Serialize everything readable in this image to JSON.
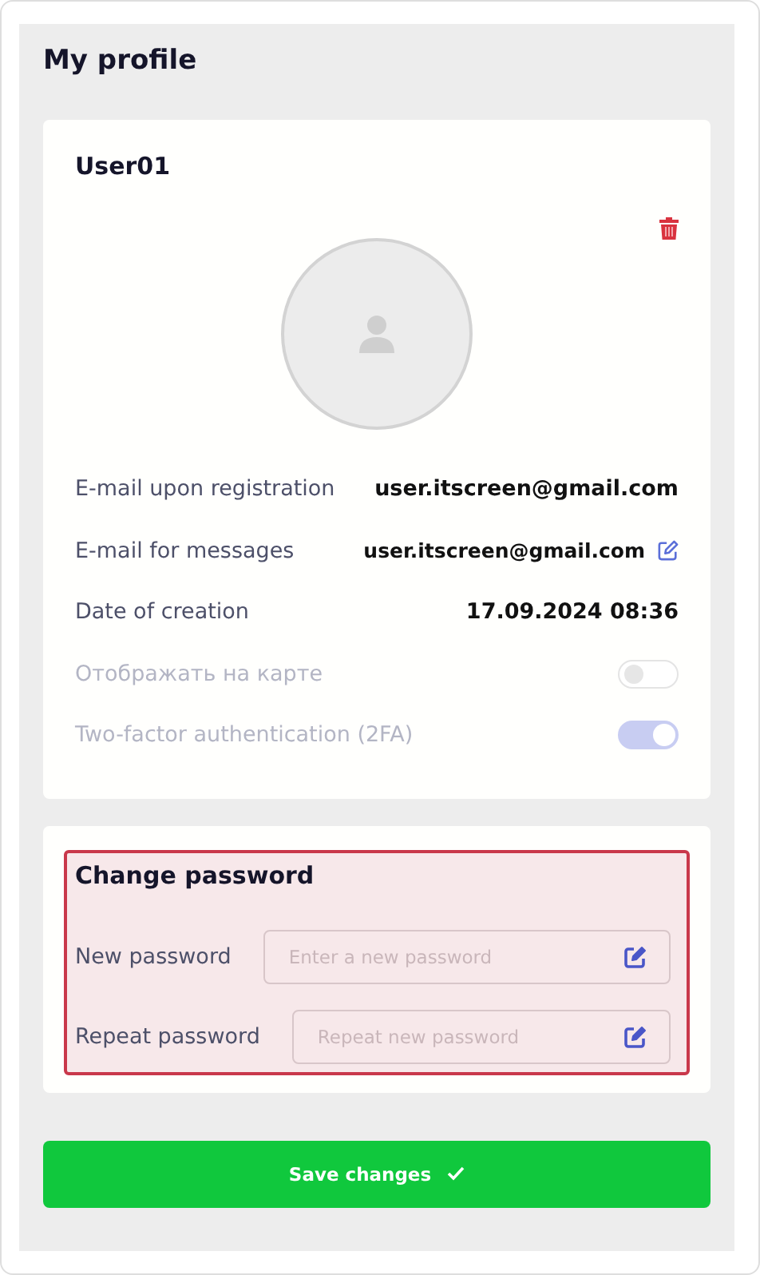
{
  "page_title": "My profile",
  "profile": {
    "username": "User01",
    "rows": [
      {
        "kind": "text",
        "label": "E-mail upon registration",
        "value": "user.itscreen@gmail.com"
      },
      {
        "kind": "editable",
        "label": "E-mail for messages",
        "value": "user.itscreen@gmail.com"
      },
      {
        "kind": "text",
        "label": "Date of creation",
        "value": "17.09.2024 08:36"
      },
      {
        "kind": "toggle",
        "label": "Отображать на карте",
        "on": false,
        "disabled": true
      },
      {
        "kind": "toggle",
        "label": "Two-factor authentication (2FA)",
        "on": true,
        "disabled": true
      }
    ]
  },
  "password": {
    "title": "Change password",
    "fields": [
      {
        "label": "New password",
        "placeholder": "Enter a new password"
      },
      {
        "label": "Repeat password",
        "placeholder": "Repeat new password"
      }
    ]
  },
  "save_button": "Save changes"
}
